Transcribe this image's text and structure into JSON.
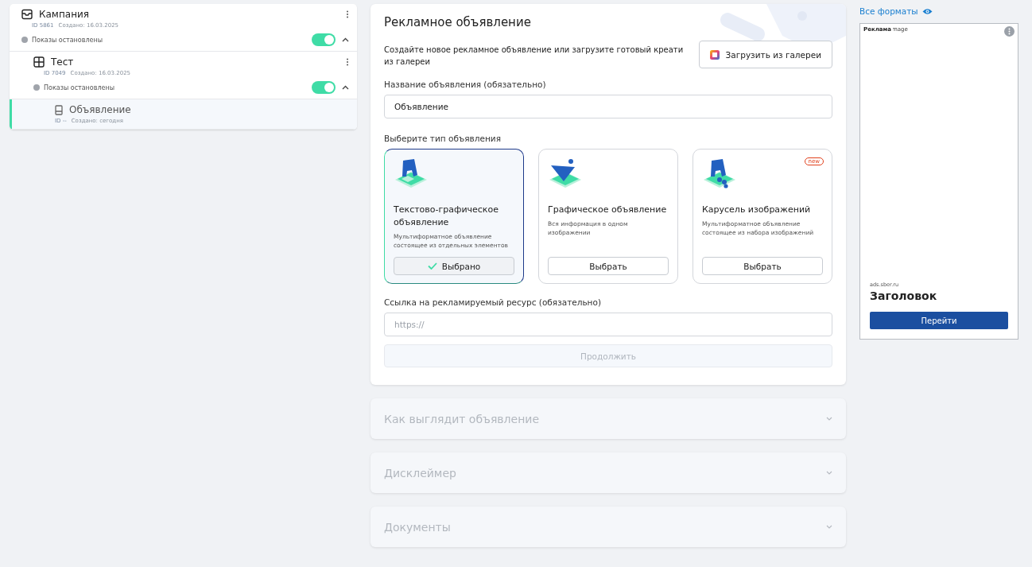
{
  "tree": [
    {
      "kind": "campaign",
      "title": "Кампания",
      "id": "ID 5861",
      "created": "Создано: 16.03.2025",
      "status": "Показы остановлены",
      "on": true,
      "expanded": true,
      "selected": false,
      "children": [
        {
          "kind": "group",
          "title": "Тест",
          "id": "ID 7049",
          "created": "Создано: 16.03.2025",
          "status": "Показы остановлены",
          "on": true,
          "expanded": true,
          "selected": false,
          "children": [
            {
              "kind": "ad",
              "title": "Объявление",
              "id": "ID --",
              "created": "Создано: сегодня",
              "selected": true
            }
          ]
        }
      ]
    }
  ],
  "editor": {
    "title": "Рекламное объявление",
    "intro": "Создайте новое рекламное объявление или загрузите готовый креати\nиз галереи",
    "gallery_button": "Загрузить из галереи",
    "name_label": "Название объявления (обязательно)",
    "name_value": "Объявление",
    "type_label": "Выберите тип объявления",
    "types": [
      {
        "kind": "text",
        "title": "Текстово-графическое объявление",
        "description": "Мультиформатное объявление состоящее из отдельных элементов",
        "button": "Выбрано",
        "selected": true
      },
      {
        "kind": "graphic",
        "title": "Графическое объявление",
        "description": "Вся информация в одном изображении",
        "button": "Выбрать",
        "selected": false
      },
      {
        "kind": "carousel",
        "title": "Карусель изображений",
        "description": "Мультиформатное объявление состоящее из набора изображений",
        "button": "Выбрать",
        "selected": false,
        "badge": "new"
      }
    ],
    "link_label": "Ссылка на рекламируемый ресурс (обязательно)",
    "link_placeholder": "https://",
    "continue_button": "Продолжить",
    "continue_disabled": true
  },
  "sections": [
    {
      "title": "Как выглядит объявление",
      "expanded": false
    },
    {
      "title": "Дисклеймер",
      "expanded": false
    },
    {
      "title": "Документы",
      "expanded": false
    }
  ],
  "preview": {
    "formats_link": "Все форматы",
    "image_alt": "mage",
    "ad_label": "Реклама",
    "domain": "ads.sber.ru",
    "headline": "Заголовок",
    "button": "Перейти"
  }
}
